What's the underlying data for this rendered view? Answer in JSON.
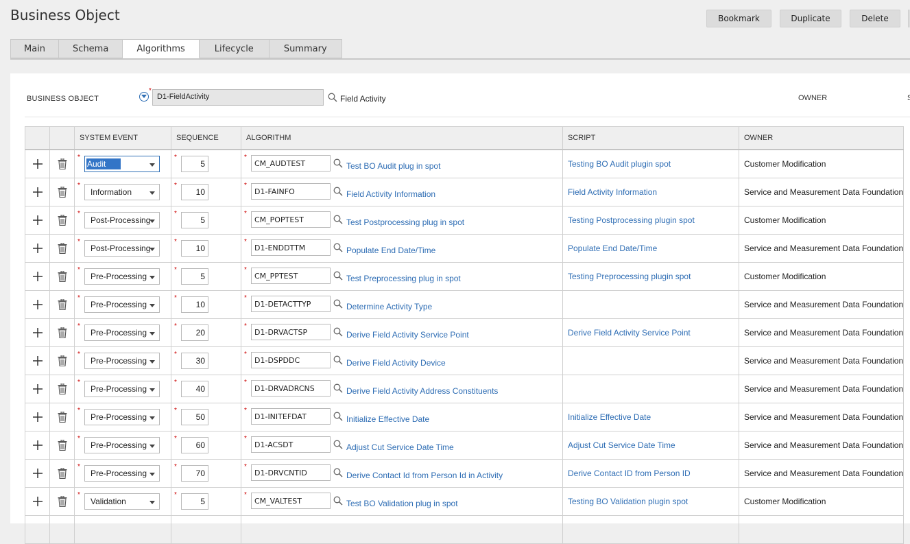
{
  "page": {
    "title": "Business Object"
  },
  "buttons": {
    "bookmark": "Bookmark",
    "duplicate": "Duplicate",
    "delete": "Delete"
  },
  "tabs": [
    {
      "label": "Main"
    },
    {
      "label": "Schema"
    },
    {
      "label": "Algorithms",
      "active": true
    },
    {
      "label": "Lifecycle"
    },
    {
      "label": "Summary"
    }
  ],
  "header": {
    "bo_label": "BUSINESS OBJECT",
    "bo_value": "D1-FieldActivity",
    "bo_desc": "Field Activity",
    "owner_label": "OWNER",
    "owner_cut": "S"
  },
  "grid": {
    "columns": [
      "SYSTEM EVENT",
      "SEQUENCE",
      "ALGORITHM",
      "SCRIPT",
      "OWNER"
    ],
    "rows": [
      {
        "event": "Audit",
        "seq": "5",
        "alg": "CM_AUDTEST",
        "alg_desc": "Test BO Audit plug in spot",
        "script": "Testing BO Audit plugin spot",
        "owner": "Customer Modification"
      },
      {
        "event": "Information",
        "seq": "10",
        "alg": "D1-FAINFO",
        "alg_desc": "Field Activity Information",
        "script": "Field Activity Information",
        "owner": "Service and Measurement Data Foundation"
      },
      {
        "event": "Post-Processing",
        "seq": "5",
        "alg": "CM_POPTEST",
        "alg_desc": "Test Postprocessing plug in spot",
        "script": "Testing Postprocessing plugin spot",
        "owner": "Customer Modification"
      },
      {
        "event": "Post-Processing",
        "seq": "10",
        "alg": "D1-ENDDTTM",
        "alg_desc": "Populate End Date/Time",
        "script": "Populate End Date/Time",
        "owner": "Service and Measurement Data Foundation"
      },
      {
        "event": "Pre-Processing",
        "seq": "5",
        "alg": "CM_PPTEST",
        "alg_desc": "Test Preprocessing plug in spot",
        "script": "Testing Preprocessing plugin spot",
        "owner": "Customer Modification"
      },
      {
        "event": "Pre-Processing",
        "seq": "10",
        "alg": "D1-DETACTTYP",
        "alg_desc": "Determine Activity Type",
        "script": "",
        "owner": "Service and Measurement Data Foundation"
      },
      {
        "event": "Pre-Processing",
        "seq": "20",
        "alg": "D1-DRVACTSP",
        "alg_desc": "Derive Field Activity Service Point",
        "script": "Derive Field Activity Service Point",
        "owner": "Service and Measurement Data Foundation"
      },
      {
        "event": "Pre-Processing",
        "seq": "30",
        "alg": "D1-DSPDDC",
        "alg_desc": "Derive Field Activity Device",
        "script": "",
        "owner": "Service and Measurement Data Foundation"
      },
      {
        "event": "Pre-Processing",
        "seq": "40",
        "alg": "D1-DRVADRCNS",
        "alg_desc": "Derive Field Activity Address Constituents",
        "script": "",
        "owner": "Service and Measurement Data Foundation"
      },
      {
        "event": "Pre-Processing",
        "seq": "50",
        "alg": "D1-INITEFDAT",
        "alg_desc": "Initialize Effective Date",
        "script": "Initialize Effective Date",
        "owner": "Service and Measurement Data Foundation"
      },
      {
        "event": "Pre-Processing",
        "seq": "60",
        "alg": "D1-ACSDT",
        "alg_desc": "Adjust Cut Service Date Time",
        "script": "Adjust Cut Service Date Time",
        "owner": "Service and Measurement Data Foundation"
      },
      {
        "event": "Pre-Processing",
        "seq": "70",
        "alg": "D1-DRVCNTID",
        "alg_desc": "Derive Contact Id from Person Id in Activity",
        "script": "Derive Contact ID from Person ID",
        "owner": "Service and Measurement Data Foundation"
      },
      {
        "event": "Validation",
        "seq": "5",
        "alg": "CM_VALTEST",
        "alg_desc": "Test BO Validation plug in spot",
        "script": "Testing BO Validation plugin spot",
        "owner": "Customer Modification"
      }
    ]
  }
}
